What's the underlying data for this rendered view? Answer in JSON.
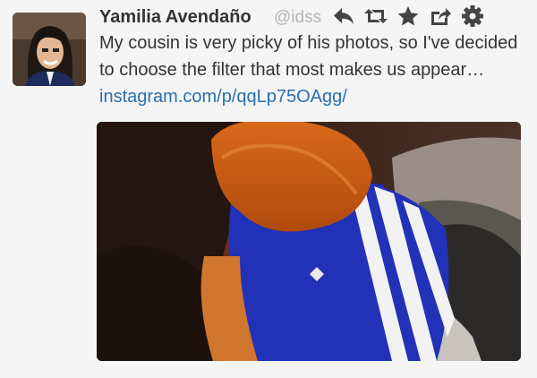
{
  "tweet": {
    "author_name": "Yamilia Avendaño",
    "author_handle": "@idss",
    "text": "My cousin is very picky of his photos, so I've decided to choose the filter that most makes us appear… ",
    "link_text": "instagram.com/p/qqLp75OAgg/"
  },
  "actions": [
    {
      "name": "reply-icon"
    },
    {
      "name": "retweet-icon"
    },
    {
      "name": "favorite-icon"
    },
    {
      "name": "share-icon"
    },
    {
      "name": "more-gear-icon"
    }
  ],
  "colors": {
    "link": "#2a6fb0",
    "text": "#333333",
    "handle": "#b5b5b5",
    "icon": "#444444",
    "background": "#f5f5f5"
  }
}
